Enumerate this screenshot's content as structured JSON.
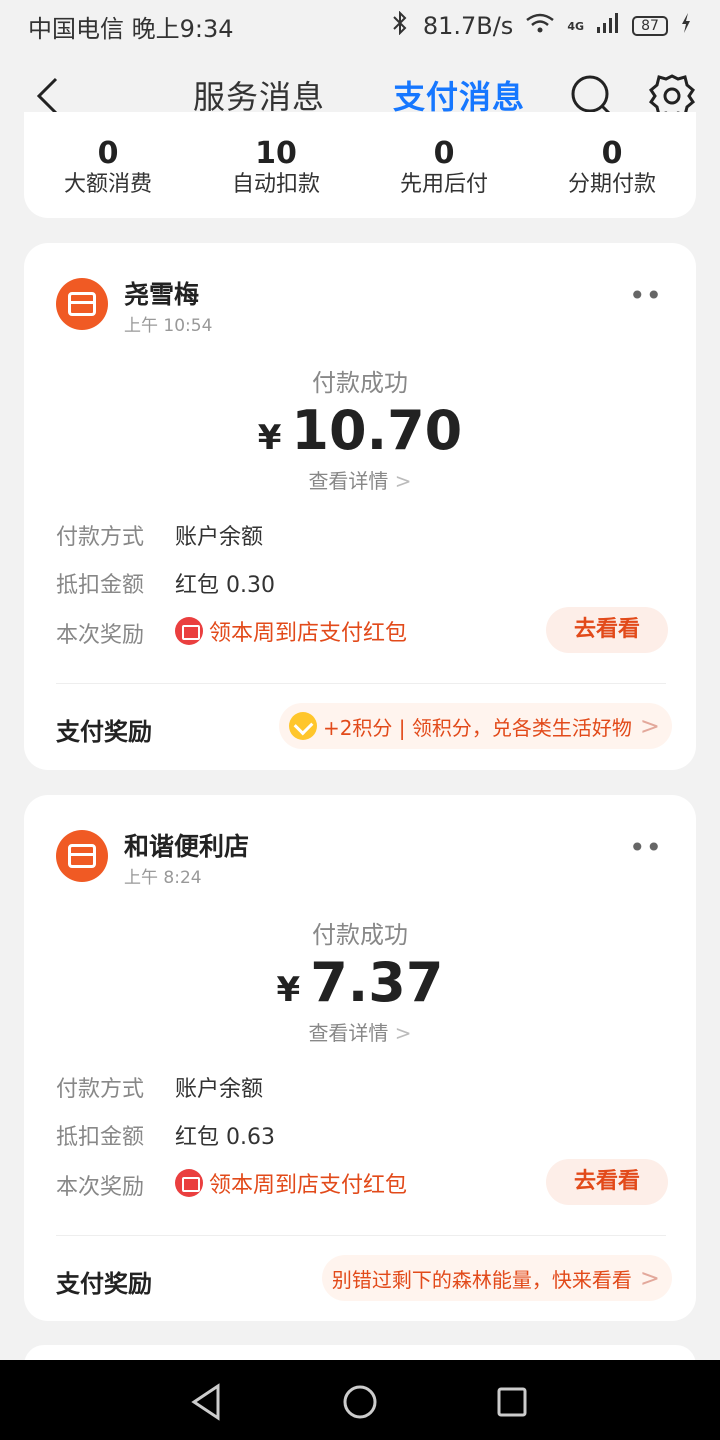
{
  "status_bar": {
    "carrier": "中国电信",
    "time": "晚上9:34",
    "speed": "81.7B/s",
    "network": "4G",
    "battery": "87"
  },
  "header": {
    "back_icon": "back-arrow-icon",
    "tabs": [
      {
        "label": "服务消息",
        "active": false
      },
      {
        "label": "支付消息",
        "active": true
      }
    ],
    "accent_color": "#1677ff"
  },
  "stats": [
    {
      "number": "0",
      "label": "大额消费"
    },
    {
      "number": "10",
      "label": "自动扣款"
    },
    {
      "number": "0",
      "label": "先用后付"
    },
    {
      "number": "0",
      "label": "分期付款"
    }
  ],
  "payments": [
    {
      "merchant": "尧雪梅",
      "time": "上午 10:54",
      "status": "付款成功",
      "currency": "¥",
      "amount": "10.70",
      "detail_link": "查看详情",
      "method_label": "付款方式",
      "method_value": "账户余额",
      "deduct_label": "抵扣金额",
      "deduct_value": "红包 0.30",
      "reward_label": "本次奖励",
      "reward_text": "领本周到店支付红包",
      "reward_button": "去看看",
      "bonus_title": "支付奖励",
      "bonus_text": "+2积分 | 领积分，兑各类生活好物"
    },
    {
      "merchant": "和谐便利店",
      "time": "上午 8:24",
      "status": "付款成功",
      "currency": "¥",
      "amount": "7.37",
      "detail_link": "查看详情",
      "method_label": "付款方式",
      "method_value": "账户余额",
      "deduct_label": "抵扣金额",
      "deduct_value": "红包 0.63",
      "reward_label": "本次奖励",
      "reward_text": "领本周到店支付红包",
      "reward_button": "去看看",
      "bonus_title": "支付奖励",
      "bonus_text": "别错过剩下的森林能量，快来看看"
    }
  ],
  "nav": [
    "back-triangle-icon",
    "home-circle-icon",
    "recent-square-icon"
  ]
}
